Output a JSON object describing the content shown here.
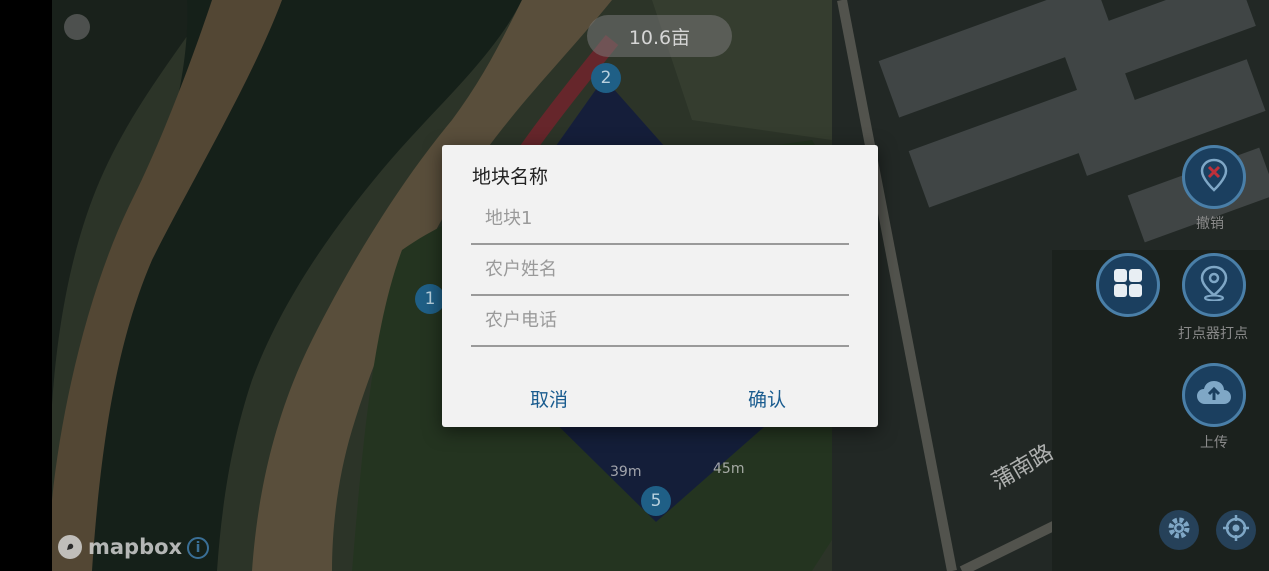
{
  "map": {
    "area_label": "10.6亩",
    "vertices": [
      "1",
      "2",
      "5"
    ],
    "segment_labels": [
      "39m",
      "45m"
    ],
    "road_name": "蒲南路",
    "attribution": "mapbox",
    "info_icon": "i",
    "colors": {
      "polygon_fill": "#1e2f6b",
      "vertex": "#1f5f86",
      "road": "#b0434a"
    }
  },
  "toolbar": {
    "undo_label": "撤销",
    "survey_point_label": "打点器打点",
    "upload_label": "上传",
    "icons": [
      "undo-marker-icon",
      "grid-icon",
      "survey-pin-icon",
      "cloud-upload-icon",
      "settings-icon",
      "locate-icon"
    ]
  },
  "dialog": {
    "title": "地块名称",
    "fields": [
      {
        "placeholder": "地块1",
        "value": ""
      },
      {
        "placeholder": "农户姓名",
        "value": ""
      },
      {
        "placeholder": "农户电话",
        "value": ""
      }
    ],
    "cancel_label": "取消",
    "confirm_label": "确认"
  }
}
